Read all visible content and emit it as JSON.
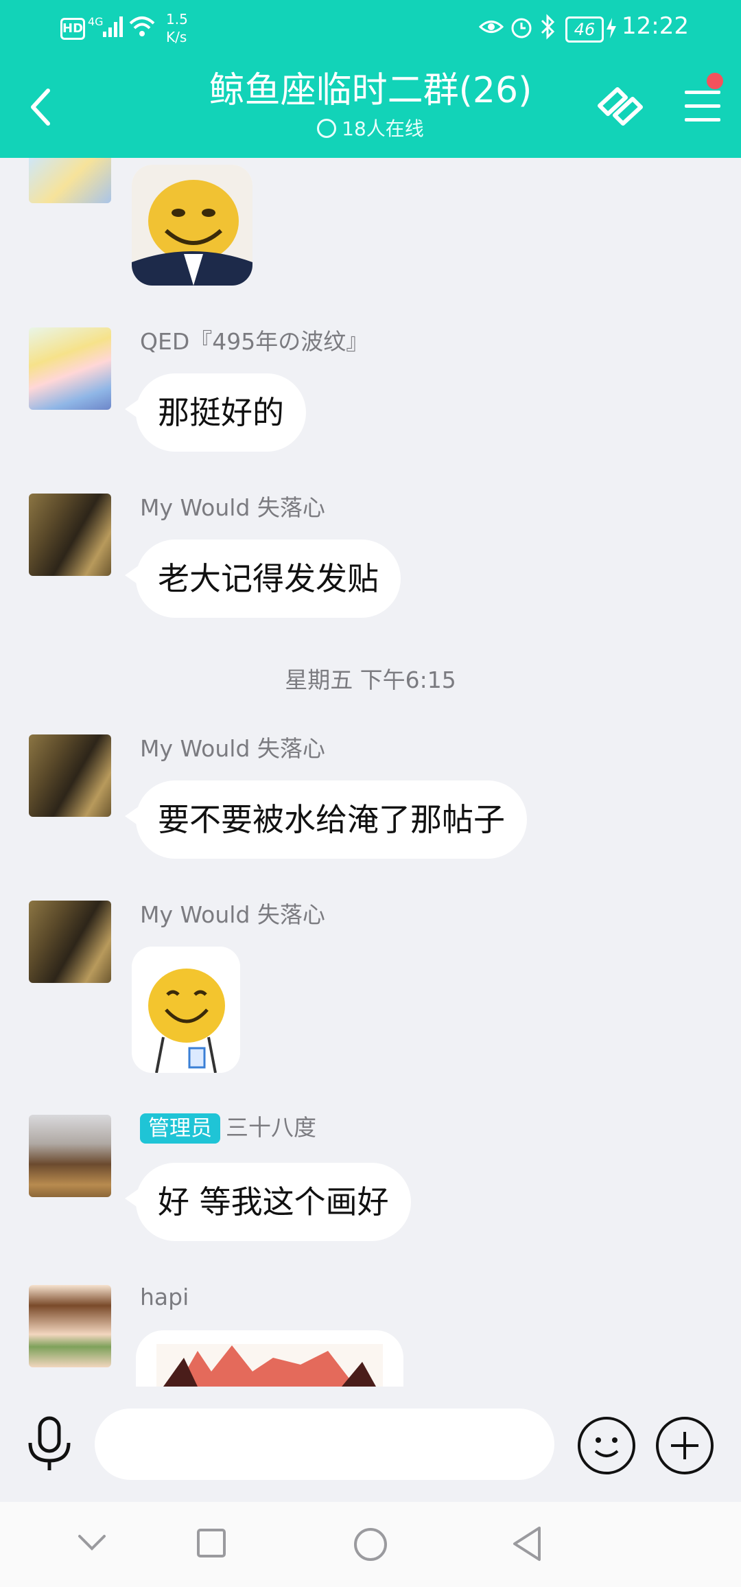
{
  "status_bar": {
    "network_speed_value": "1.5",
    "network_speed_unit": "K/s",
    "signal": "4G",
    "hd": "HD",
    "battery": "46",
    "time": "12:22"
  },
  "header": {
    "title": "鲸鱼座临时二群(26)",
    "online": "18人在线",
    "accent": "#12d3b8"
  },
  "messages": [
    {
      "sender": "QED『495年の波纹』",
      "text": "那挺好的"
    },
    {
      "sender": "My Would 失落心",
      "text": "老大记得发发贴"
    },
    {
      "sender": "My Would 失落心",
      "text": "要不要被水给淹了那帖子"
    },
    {
      "sender": "My Would 失落心",
      "sticker": "smiley-face-sticker"
    },
    {
      "badge": "管理员",
      "sender": "三十八度",
      "text": "好 等我这个画好"
    },
    {
      "sender": "hapi",
      "sticker": "image-partial"
    }
  ],
  "timestamp": "星期五 下午6:15",
  "input": {
    "placeholder": ""
  },
  "icons": {
    "back": "back-arrow-icon",
    "share": "link-icon",
    "menu": "menu-icon",
    "voice": "microphone-icon",
    "emoji": "emoji-icon",
    "plus": "plus-icon"
  }
}
